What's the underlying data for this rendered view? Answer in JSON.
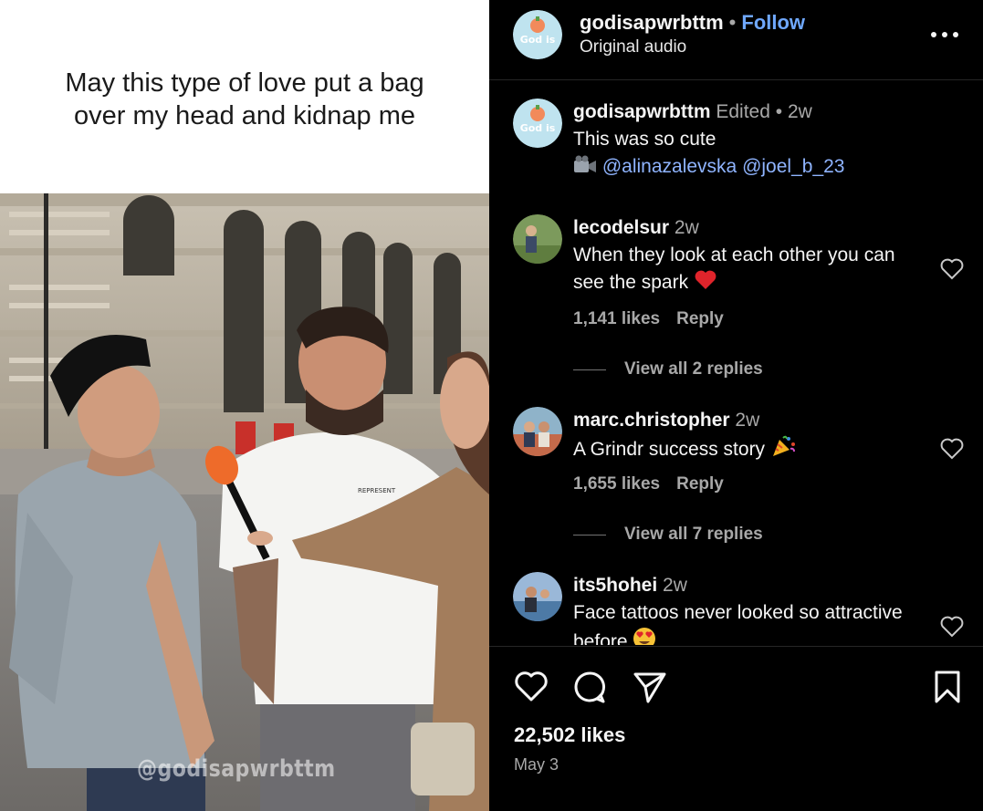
{
  "post": {
    "overlay_caption": "May this type of love put a bag over my head and kidnap me",
    "watermark": "@godisapwrbttm",
    "author": "godisapwrbttm",
    "follow_label": "Follow",
    "audio": "Original audio",
    "avatar_text": "God is"
  },
  "caption": {
    "username": "godisapwrbttm",
    "edited": "Edited",
    "age": "2w",
    "text": "This was so cute",
    "mention_1": "@alinazalevska",
    "mention_2": "@joel_b_23"
  },
  "comments": [
    {
      "username": "lecodelsur",
      "age": "2w",
      "text": "When they look at each other you can see the spark",
      "emoji": "red-heart",
      "likes": "1,141 likes",
      "reply_label": "Reply",
      "view_replies": "View all 2 replies"
    },
    {
      "username": "marc.christopher",
      "age": "2w",
      "text": "A Grindr success story",
      "emoji": "party-popper",
      "likes": "1,655 likes",
      "reply_label": "Reply",
      "view_replies": "View all 7 replies"
    },
    {
      "username": "its5hohei",
      "age": "2w",
      "text": "Face tattoos never looked so attractive before",
      "emoji": "heart-eyes"
    }
  ],
  "footer": {
    "likes": "22,502 likes",
    "date": "May 3"
  },
  "colors": {
    "background": "#000000",
    "link": "#6fa8ff",
    "muted": "#a8a8a8",
    "divider": "#262626"
  }
}
